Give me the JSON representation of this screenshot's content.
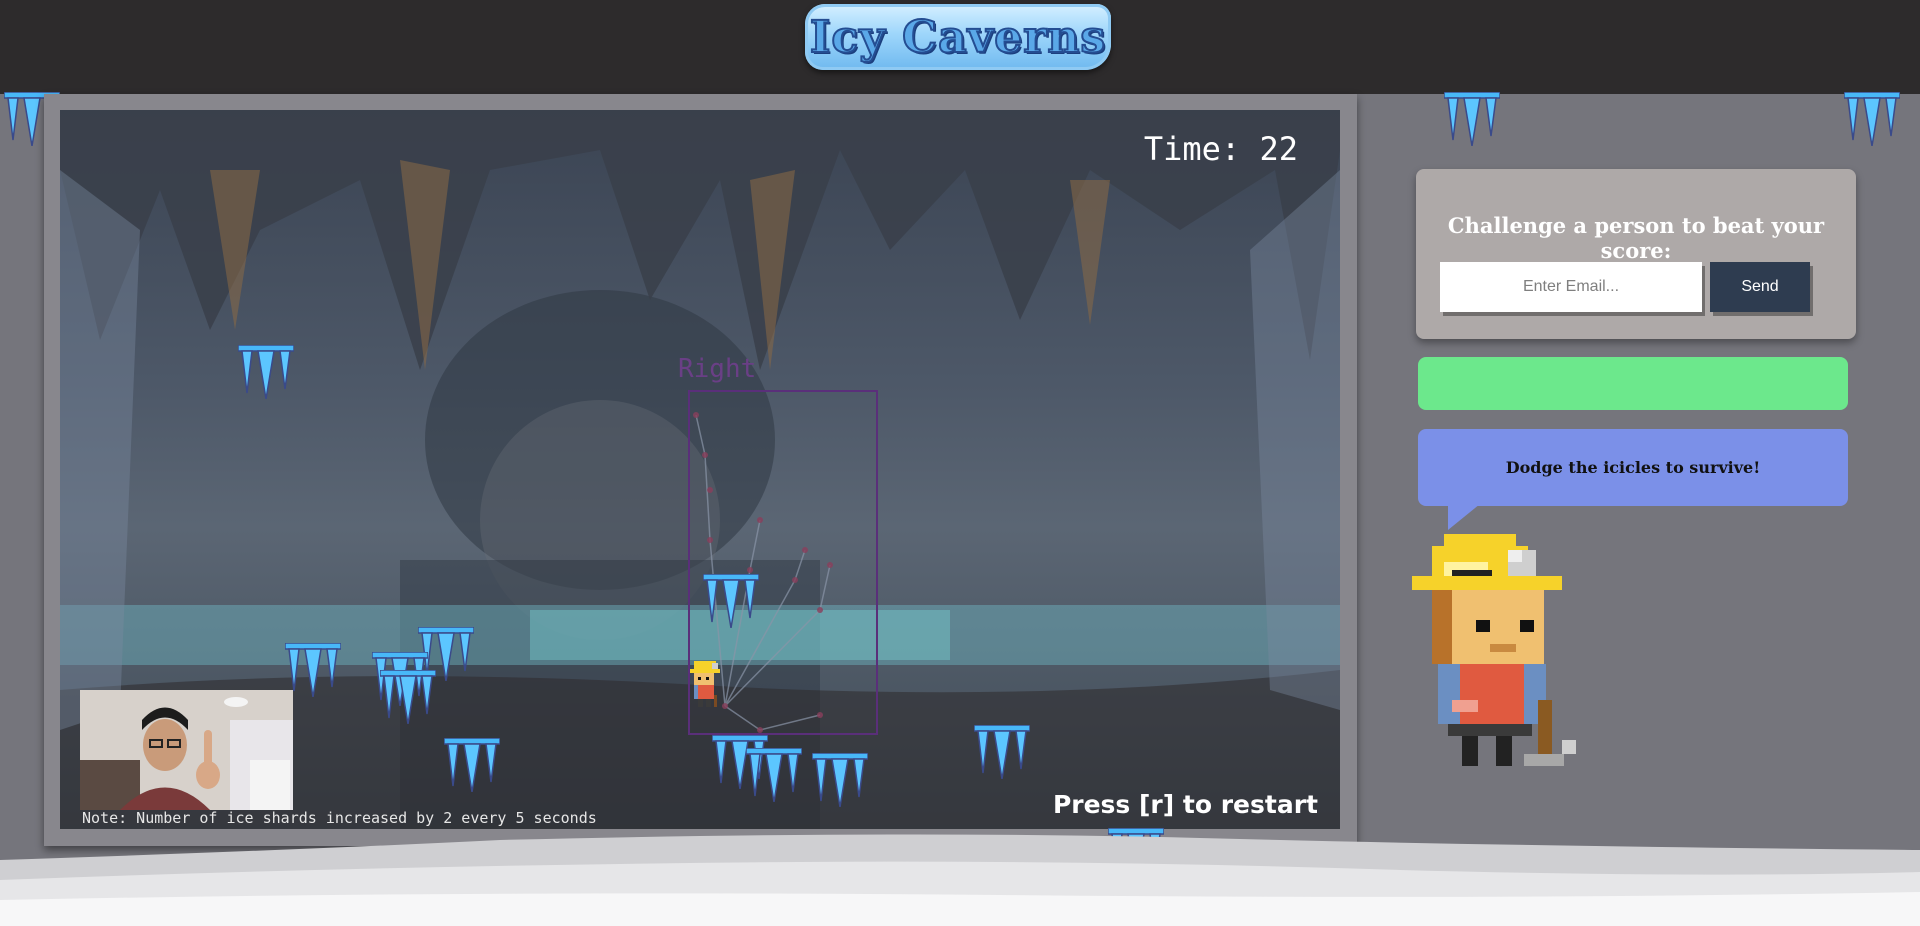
{
  "header": {
    "logo_text": "Icy Caverns"
  },
  "game": {
    "timer_text": "Time: 22",
    "restart_text": "Press [r] to restart",
    "note_text": "Note: Number of ice shards increased by 2 every 5 seconds",
    "hand_label": "Right"
  },
  "sidebar": {
    "challenge_title": "Challenge a person to beat your score:",
    "email_placeholder": "Enter Email...",
    "email_value": "",
    "send_label": "Send",
    "status_text": "",
    "tip_text": "Dodge the icicles to survive!"
  },
  "colors": {
    "status_bar": "#6ce88c",
    "speech_bubble": "#7b90e8",
    "send_button": "#2e3c50",
    "icicle": "#48b8f8"
  },
  "icons": {
    "player": "miner-sprite",
    "hazard": "icicle-icon",
    "mascot": "miner-mascot"
  }
}
